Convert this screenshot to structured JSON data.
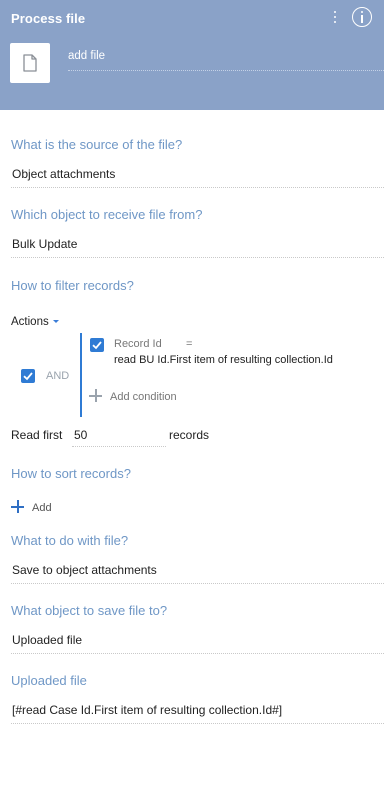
{
  "header": {
    "title": "Process file",
    "element_name": "add file",
    "file_icon": "document-icon",
    "menu_icon": "vertical-dots-icon",
    "info_icon": "info-icon",
    "background_color": "#8aa2c8"
  },
  "source": {
    "question": "What is the source of the file?",
    "value": "Object attachments"
  },
  "object_from": {
    "question": "Which object to receive file from?",
    "value": "Bulk Update"
  },
  "filter": {
    "question": "How to filter records?",
    "actions_label": "Actions",
    "group_checked": true,
    "group_operator": "AND",
    "condition": {
      "checked": true,
      "column": "Record Id",
      "operator": "=",
      "value": "read BU Id.First item of resulting collection.Id"
    },
    "add_condition_label": "Add condition",
    "read_first_label": "Read first",
    "read_first_value": "50",
    "read_first_unit": "records"
  },
  "sort": {
    "question": "How to sort records?",
    "add_label": "Add"
  },
  "action": {
    "question": "What to do with file?",
    "value": "Save to object attachments"
  },
  "save_object": {
    "question": "What object to save file to?",
    "value": "Uploaded file"
  },
  "uploaded_file": {
    "question": "Uploaded file",
    "value": "[#read Case Id.First item of resulting collection.Id#]"
  },
  "colors": {
    "accent": "#2f7bd4",
    "question_text": "#6f97c6"
  }
}
